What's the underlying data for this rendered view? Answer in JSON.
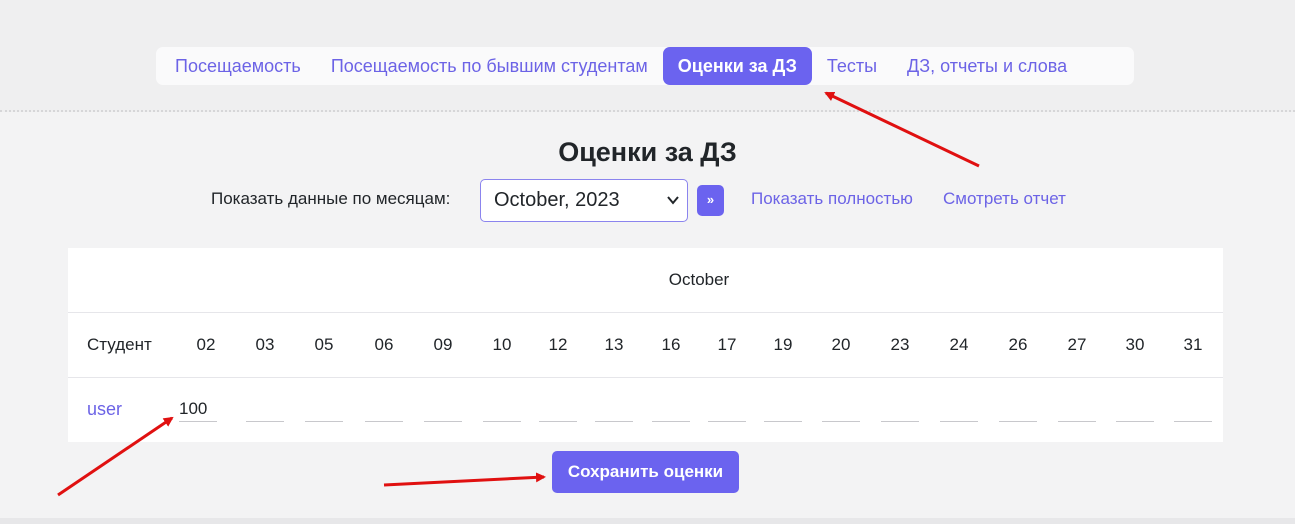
{
  "tabs": [
    {
      "label": "Посещаемость",
      "active": false
    },
    {
      "label": "Посещаемость по бывшим студентам",
      "active": false
    },
    {
      "label": "Оценки за ДЗ",
      "active": true
    },
    {
      "label": "Тесты",
      "active": false
    },
    {
      "label": "ДЗ, отчеты и слова",
      "active": false
    }
  ],
  "page": {
    "title": "Оценки за ДЗ"
  },
  "filter": {
    "label": "Показать данные по месяцам:",
    "selected_month": "October, 2023",
    "go_label": "»",
    "show_full_link": "Показать полностью",
    "view_report_link": "Смотреть отчет"
  },
  "table": {
    "month": "October",
    "student_header": "Студент",
    "days": [
      "02",
      "03",
      "05",
      "06",
      "09",
      "10",
      "12",
      "13",
      "16",
      "17",
      "19",
      "20",
      "23",
      "24",
      "26",
      "27",
      "30",
      "31"
    ],
    "rows": [
      {
        "student": "user",
        "grades": [
          "100",
          "",
          "",
          "",
          "",
          "",
          "",
          "",
          "",
          "",
          "",
          "",
          "",
          "",
          "",
          "",
          "",
          ""
        ]
      }
    ]
  },
  "actions": {
    "save_label": "Сохранить оценки"
  },
  "colors": {
    "accent": "#6b63ef",
    "link": "#6c63e6",
    "annotation_arrow": "#e01010"
  }
}
